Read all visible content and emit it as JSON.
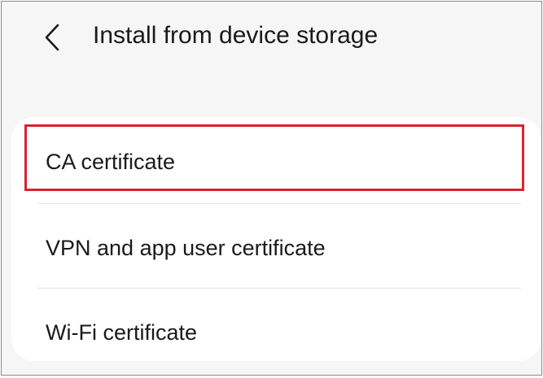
{
  "header": {
    "back_icon": "chevron-left-icon",
    "title": "Install from device storage"
  },
  "list": {
    "items": [
      {
        "label": "CA certificate",
        "highlighted": true
      },
      {
        "label": "VPN and app user certificate",
        "highlighted": false
      },
      {
        "label": "Wi-Fi certificate",
        "highlighted": false
      }
    ]
  },
  "colors": {
    "background": "#f6f6f6",
    "card": "#ffffff",
    "text": "#1a1a1a",
    "highlight_border": "#d9232f",
    "divider": "#e2e2e2"
  }
}
